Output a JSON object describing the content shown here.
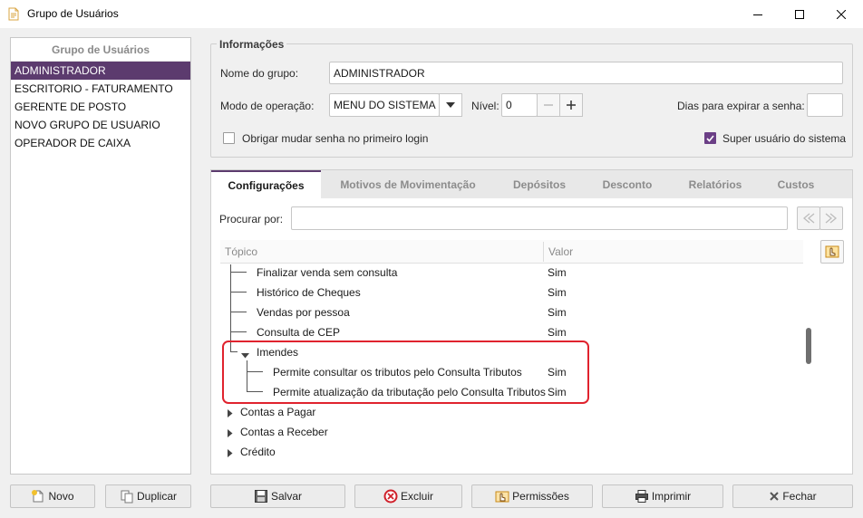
{
  "window": {
    "title": "Grupo de Usuários",
    "icon": "document-icon"
  },
  "left_panel": {
    "header": "Grupo de Usuários",
    "items": [
      {
        "label": "ADMINISTRADOR",
        "selected": true
      },
      {
        "label": "ESCRITORIO - FATURAMENTO"
      },
      {
        "label": "GERENTE DE POSTO"
      },
      {
        "label": "NOVO GRUPO DE USUARIO"
      },
      {
        "label": "OPERADOR DE CAIXA"
      }
    ],
    "novo_label": "Novo",
    "duplicar_label": "Duplicar"
  },
  "info": {
    "title": "Informações",
    "nome_label": "Nome do grupo:",
    "nome_value": "ADMINISTRADOR",
    "modo_label": "Modo de operação:",
    "modo_value": "MENU DO SISTEMA",
    "nivel_label": "Nível:",
    "nivel_value": "0",
    "dias_label": "Dias para expirar a senha:",
    "dias_value": "",
    "obrigar_label": "Obrigar mudar senha no primeiro login",
    "obrigar_checked": false,
    "super_label": "Super usuário do sistema",
    "super_checked": true
  },
  "tabs": [
    {
      "label": "Configurações",
      "active": true
    },
    {
      "label": "Motivos de Movimentação"
    },
    {
      "label": "Depósitos"
    },
    {
      "label": "Desconto"
    },
    {
      "label": "Relatórios"
    },
    {
      "label": "Custos"
    }
  ],
  "search": {
    "label": "Procurar por:",
    "value": ""
  },
  "tree": {
    "col_topico": "Tópico",
    "col_valor": "Valor",
    "rows": [
      {
        "label": "Finalizar venda sem consulta",
        "value": "Sim"
      },
      {
        "label": "Histórico de Cheques",
        "value": "Sim"
      },
      {
        "label": "Vendas por pessoa",
        "value": "Sim"
      },
      {
        "label": "Consulta de CEP",
        "value": "Sim"
      },
      {
        "label": "Imendes",
        "value": "",
        "expanded": true
      },
      {
        "label": "Permite consultar os tributos pelo Consulta Tributos",
        "value": "Sim"
      },
      {
        "label": "Permite atualização da tributação pelo Consulta Tributos",
        "value": "Sim"
      },
      {
        "label": "Contas a Pagar",
        "value": "",
        "expanded": false
      },
      {
        "label": "Contas a Receber",
        "value": "",
        "expanded": false
      },
      {
        "label": "Crédito",
        "value": "",
        "expanded": false
      }
    ]
  },
  "footer": {
    "salvar": "Salvar",
    "excluir": "Excluir",
    "permissoes": "Permissões",
    "imprimir": "Imprimir",
    "fechar": "Fechar"
  },
  "colors": {
    "accent": "#5c3b6e",
    "checkbox_checked": "#6b3f86",
    "highlight": "#e0232e"
  }
}
